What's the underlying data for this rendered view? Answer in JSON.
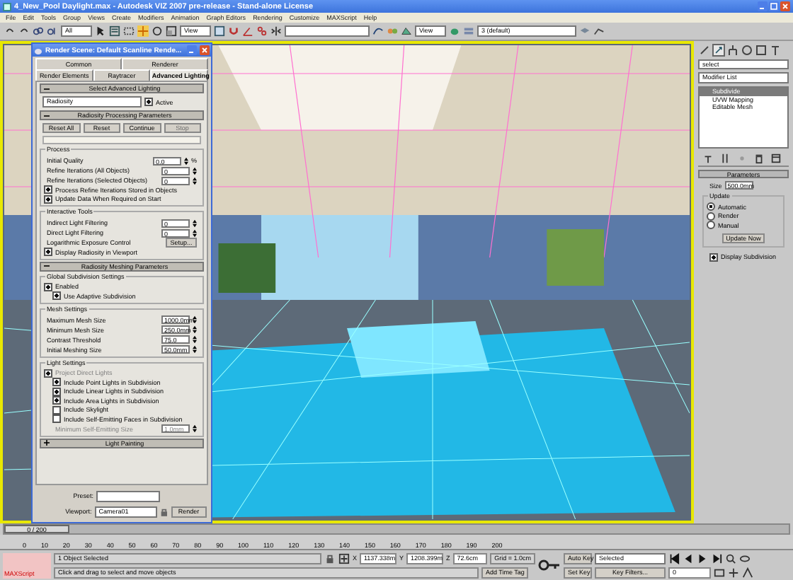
{
  "window": {
    "title": "4_New_Pool Daylight.max - Autodesk VIZ 2007 pre-release - Stand-alone License"
  },
  "menu": [
    "File",
    "Edit",
    "Tools",
    "Group",
    "Views",
    "Create",
    "Modifiers",
    "Animation",
    "Graph Editors",
    "Rendering",
    "Customize",
    "MAXScript",
    "Help"
  ],
  "toolbar": {
    "selection_filter": "All",
    "reference_coords": "View",
    "render_view": "View",
    "layer": "3 (default)"
  },
  "render_dialog": {
    "title": "Render Scene: Default Scanline Rende...",
    "tabs": [
      {
        "label": "Common",
        "selected": false
      },
      {
        "label": "Renderer",
        "selected": false
      },
      {
        "label": "Render Elements",
        "selected": false
      },
      {
        "label": "Raytracer",
        "selected": false
      },
      {
        "label": "Advanced Lighting",
        "selected": true
      }
    ],
    "select_lighting": {
      "header": "Select Advanced Lighting",
      "expanded": true,
      "plugin": "Radiosity",
      "active": {
        "label": "Active",
        "checked": true
      }
    },
    "processing": {
      "header": "Radiosity Processing Parameters",
      "expanded": true,
      "buttons": [
        {
          "label": "Reset All",
          "disabled": false
        },
        {
          "label": "Reset",
          "disabled": false
        },
        {
          "label": "Continue",
          "disabled": false
        },
        {
          "label": "Stop",
          "disabled": true
        }
      ],
      "progress": {
        "level": 0
      },
      "groups": [
        {
          "title": "Process",
          "items": [
            {
              "kind": "spinner",
              "label": "Initial Quality",
              "value": "0.0",
              "unit": "%",
              "disabled": false
            },
            {
              "kind": "spinner",
              "label": "Refine Iterations (All Objects)",
              "value": "0",
              "disabled": false
            },
            {
              "kind": "spinner",
              "label": "Refine Iterations (Selected Objects)",
              "value": "0",
              "disabled": false
            },
            {
              "kind": "check",
              "label": "Process Refine Iterations Stored in Objects",
              "checked": true,
              "disabled": false
            },
            {
              "kind": "check",
              "label": "Update Data When Required on Start",
              "checked": true,
              "disabled": false
            }
          ]
        },
        {
          "title": "Interactive Tools",
          "items": [
            {
              "kind": "spinner",
              "label": "Indirect Light Filtering",
              "value": "0",
              "disabled": false
            },
            {
              "kind": "spinner",
              "label": "Direct Light Filtering",
              "value": "0",
              "disabled": false
            },
            {
              "kind": "button",
              "label": "Logarithmic Exposure Control",
              "button": "Setup..."
            },
            {
              "kind": "check",
              "label": "Display Radiosity in Viewport",
              "checked": true,
              "disabled": false
            }
          ]
        }
      ]
    },
    "meshing": {
      "header": "Radiosity Meshing Parameters",
      "expanded": true,
      "groups": [
        {
          "title": "Global Subdivision Settings",
          "items": [
            {
              "kind": "check",
              "label": "Enabled",
              "checked": true,
              "disabled": false,
              "children": [
                {
                  "kind": "check",
                  "label": "Use Adaptive Subdivision",
                  "checked": true,
                  "disabled": false
                }
              ]
            }
          ]
        },
        {
          "title": "Mesh Settings",
          "items": [
            {
              "kind": "spinner",
              "label": "Maximum Mesh Size",
              "value": "1000.0mm",
              "disabled": false
            },
            {
              "kind": "spinner",
              "label": "Minimum Mesh Size",
              "value": "250.0mm",
              "disabled": false
            },
            {
              "kind": "spinner",
              "label": "Contrast Threshold",
              "value": "75.0",
              "disabled": false
            },
            {
              "kind": "spinner",
              "label": "Initial Meshing Size",
              "value": "50.0mm",
              "disabled": false
            }
          ]
        },
        {
          "title": "Light Settings",
          "items": [
            {
              "kind": "check",
              "label": "Project Direct Lights",
              "checked": true,
              "disabled": true,
              "children": [
                {
                  "kind": "check",
                  "label": "Include Point Lights in Subdivision",
                  "checked": true,
                  "disabled": false
                },
                {
                  "kind": "check",
                  "label": "Include Linear Lights in Subdivision",
                  "checked": true,
                  "disabled": false
                },
                {
                  "kind": "check",
                  "label": "Include Area Lights in Subdivision",
                  "checked": true,
                  "disabled": false
                },
                {
                  "kind": "check",
                  "label": "Include Skylight",
                  "checked": false,
                  "disabled": false
                },
                {
                  "kind": "check",
                  "label": "Include Self-Emitting Faces in Subdivision",
                  "checked": false,
                  "disabled": false
                },
                {
                  "kind": "spinner",
                  "label": "Minimum Self-Emitting Size",
                  "value": "1.0mm",
                  "disabled": true
                }
              ]
            }
          ]
        }
      ]
    },
    "collapsed": [
      {
        "header": "Light Painting",
        "expanded": false
      }
    ],
    "preset": {
      "label": "Preset:"
    },
    "viewport": {
      "label": "Viewport:",
      "value": "Camera01"
    },
    "render_button": "Render"
  },
  "command_panel": {
    "tabs": [
      {
        "selected": false
      },
      {
        "selected": true
      },
      {
        "selected": false
      },
      {
        "selected": false
      },
      {
        "selected": false
      },
      {
        "selected": false
      }
    ],
    "object_name": "select",
    "modifier_list": "Modifier List",
    "stack": [
      {
        "label": "Subdivide",
        "selected": true
      },
      {
        "label": "UVW Mapping",
        "selected": false
      },
      {
        "label": "Editable Mesh",
        "selected": false
      }
    ],
    "parameters": {
      "header": "Parameters",
      "size": {
        "label": "Size",
        "value": "500.0mm"
      },
      "update_title": "Update",
      "radios": [
        {
          "label": "Automatic",
          "selected": true
        },
        {
          "label": "Render",
          "selected": false
        },
        {
          "label": "Manual",
          "selected": false
        }
      ],
      "update_button": "Update Now",
      "display": {
        "label": "Display Subdivision",
        "checked": true
      }
    }
  },
  "time_slider": "0 / 200",
  "ruler": [
    "0",
    "10",
    "20",
    "30",
    "40",
    "50",
    "60",
    "70",
    "80",
    "90",
    "100",
    "110",
    "120",
    "130",
    "140",
    "150",
    "160",
    "170",
    "180",
    "190",
    "200"
  ],
  "status_bar": {
    "listener": "MAXScript",
    "selection": "1 Object Selected",
    "prompt": "Click and drag to select and move objects",
    "coords": [
      {
        "axis": "X",
        "value": "1137.338m"
      },
      {
        "axis": "Y",
        "value": "1208.399m"
      },
      {
        "axis": "Z",
        "value": "72.6cm"
      }
    ],
    "grid": "Grid = 1.0cm",
    "time_tag": "Add Time Tag",
    "auto_key": "Auto Key",
    "key_mode": "Selected",
    "set_key": "Set Key",
    "key_filters": "Key Filters...",
    "frame": "0"
  }
}
